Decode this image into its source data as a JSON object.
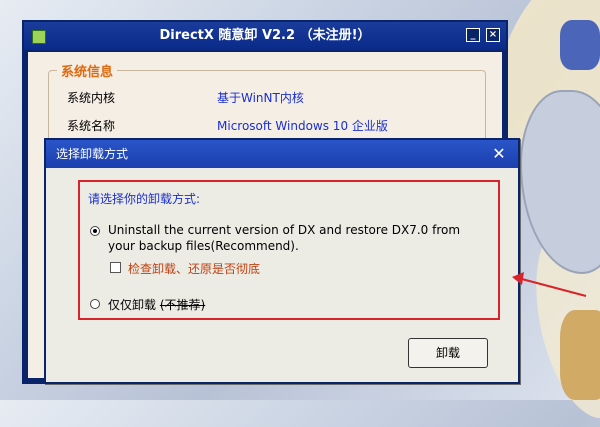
{
  "main_window": {
    "title": "DirectX 随意卸 V2.2 （未注册!）",
    "group_title": "系统信息",
    "rows": [
      {
        "label": "系统内核",
        "value": "基于WinNT内核"
      },
      {
        "label": "系统名称",
        "value": "Microsoft Windows 10 企业版"
      }
    ],
    "title_buttons": [
      "minimize",
      "close"
    ]
  },
  "dialog": {
    "title": "选择卸载方式",
    "prompt": "请选择你的卸载方式:",
    "option1": {
      "text": "Uninstall the current version of DX and restore DX7.0 from your backup files(Recommend).",
      "checked": true
    },
    "checkbox": {
      "label": "检查卸载、还原是否彻底",
      "checked": false
    },
    "option2": {
      "text": "仅仅卸载",
      "note": "(不推荐)",
      "checked": false
    },
    "uninstall_button": "卸载",
    "close_icon": "close-icon"
  },
  "colors": {
    "highlight_box": "#d8232a",
    "title_bar": "#1b3fae",
    "info_value": "#1a2fd0",
    "group_title": "#e06a10"
  }
}
